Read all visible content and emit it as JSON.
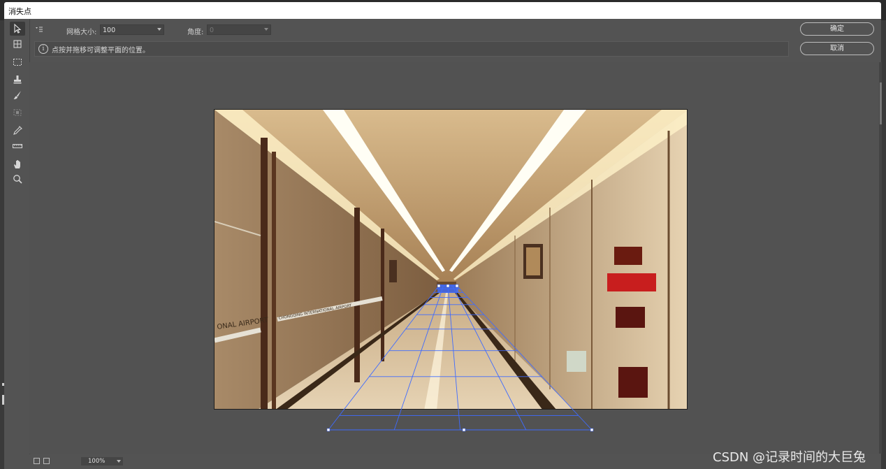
{
  "window": {
    "title": "消失点"
  },
  "options": {
    "menu_icon": "flyout-menu-icon",
    "grid_size_label": "网格大小:",
    "grid_size_value": "100",
    "angle_label": "角度:",
    "angle_value": "0"
  },
  "info": {
    "icon": "info-icon",
    "message": "点按并拖移可调整平面的位置。"
  },
  "buttons": {
    "ok": "确定",
    "cancel": "取消"
  },
  "tools": [
    "select-arrow-icon",
    "create-plane-icon",
    "marquee-icon",
    "stamp-icon",
    "brush-icon",
    "transform-icon",
    "eyedropper-icon",
    "ruler-icon",
    "hand-icon",
    "zoom-icon"
  ],
  "status": {
    "zoom": "100%"
  },
  "canvas": {
    "photo_signs": [
      "ONAL AIRPORT",
      "CHONGQING INTERNATIONAL AIRPORT"
    ],
    "grid_color": "#3f6bff"
  },
  "watermark": "CSDN @记录时间的大巨兔"
}
